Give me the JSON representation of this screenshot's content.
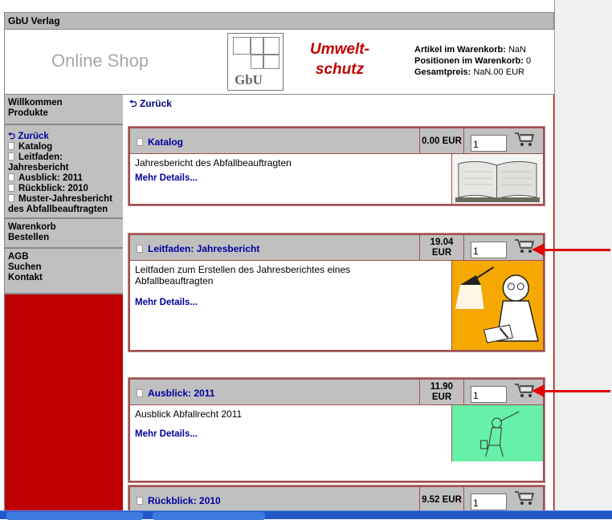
{
  "header": {
    "title": "GbU Verlag"
  },
  "banner": {
    "online_shop": "Online Shop",
    "logo_text": "GbU",
    "umwelt_line1": "Umwelt-",
    "umwelt_line2": "schutz",
    "cart_articles_label": "Artikel im Warenkorb:",
    "cart_articles_value": "NaN",
    "cart_positions_label": "Positionen im Warenkorb:",
    "cart_positions_value": "0",
    "total_label": "Gesamtpreis:",
    "total_value": "NaN.00 EUR"
  },
  "sidebar": {
    "block1": [
      "Willkommen",
      "Produkte"
    ],
    "back": "Zurück",
    "items": [
      "Katalog",
      "Leitfaden: Jahresbericht",
      "Ausblick: 2011",
      "Rückblick: 2010",
      "Muster-Jahresbericht des Abfallbeauftragten"
    ],
    "block2": [
      "Warenkorb",
      "Bestellen"
    ],
    "block3": [
      "AGB",
      "Suchen",
      "Kontakt"
    ]
  },
  "content": {
    "back": "Zurück"
  },
  "products": [
    {
      "title": "Katalog",
      "price": "0.00 EUR",
      "qty": "1",
      "desc": "Jahresbericht des Abfallbeauftragten",
      "more": "Mehr Details..."
    },
    {
      "title": "Leitfaden: Jahresbericht",
      "price": "19.04 EUR",
      "qty": "1",
      "desc": "Leitfaden zum Erstellen des Jahresberichtes eines Abfallbeauftragten",
      "more": "Mehr Details..."
    },
    {
      "title": "Ausblick: 2011",
      "price": "11.90 EUR",
      "qty": "1",
      "desc": "Ausblick Abfallrecht 2011",
      "more": "Mehr Details..."
    },
    {
      "title": "Rückblick: 2010",
      "price": "9.52 EUR",
      "qty": "1",
      "desc": "",
      "more": ""
    }
  ],
  "colors": {
    "accent_red": "#c00000",
    "link_blue": "#0000a0",
    "header_gray": "#c0c0c0",
    "annotation_arrow": "#e00000"
  }
}
